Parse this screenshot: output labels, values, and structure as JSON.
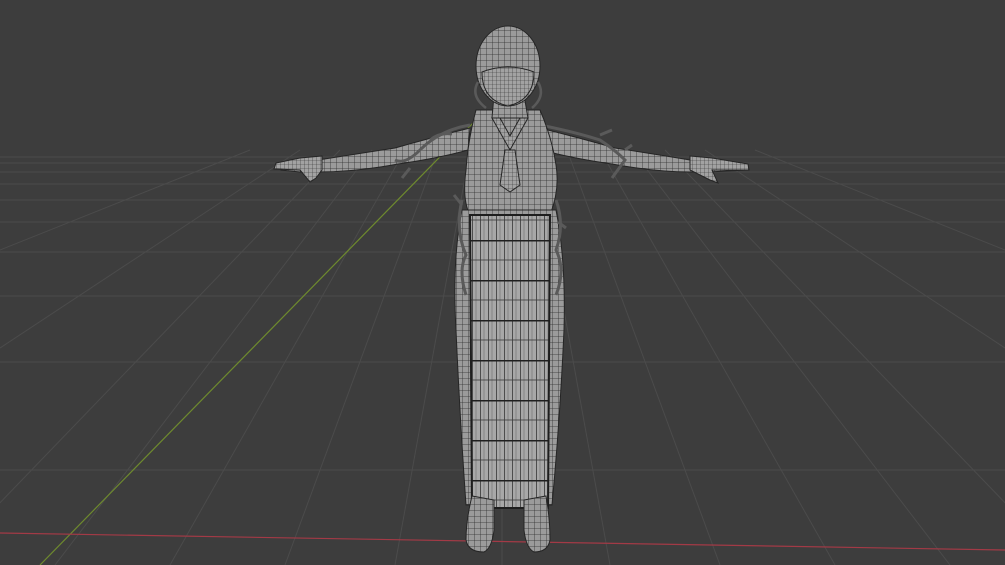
{
  "app": {
    "view": "3D Viewport",
    "shading": "wireframe-overlay",
    "background_color": "#3d3d3d",
    "grid_color": "#4a4a4a",
    "x_axis_color": "#a33a46",
    "y_axis_color": "#6e8a2e",
    "mesh_color": "#9a9a9a",
    "wire_color": "#2b2b2b"
  }
}
